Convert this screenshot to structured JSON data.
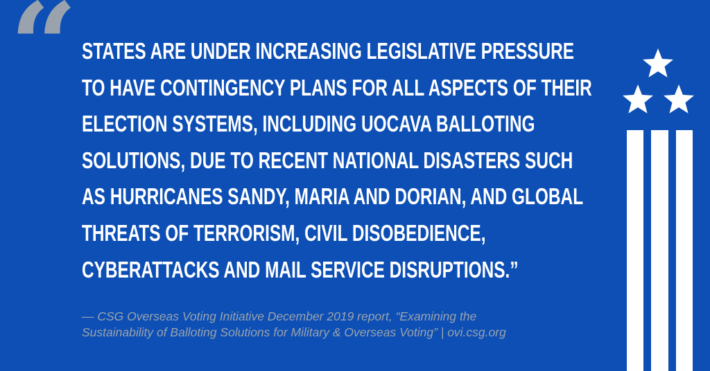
{
  "quote": {
    "open_mark": "“",
    "lines": [
      "STATES ARE UNDER INCREASING LEGISLATIVE PRESSURE",
      "TO HAVE CONTINGENCY PLANS FOR ALL ASPECTS OF THEIR",
      "ELECTION SYSTEMS, INCLUDING UOCAVA BALLOTING",
      "SOLUTIONS, DUE TO RECENT NATIONAL DISASTERS SUCH",
      "AS HURRICANES SANDY, MARIA AND DORIAN, AND GLOBAL",
      "THREATS OF TERRORISM, CIVIL DISOBEDIENCE,",
      "CYBERATTACKS AND MAIL SERVICE DISRUPTIONS.”"
    ]
  },
  "attribution": {
    "lines": [
      "— CSG Overseas Voting Initiative December 2019 report, “Examining the",
      "Sustainability of Balloting Solutions for Military & Overseas Voting” | ovi.csg.org"
    ]
  },
  "colors": {
    "background": "#0d4fb5",
    "text": "#ffffff",
    "muted": "#9aa3ad"
  },
  "icons": [
    "open-quote-icon",
    "star-icon",
    "star-icon",
    "star-icon",
    "stripes-icon"
  ]
}
